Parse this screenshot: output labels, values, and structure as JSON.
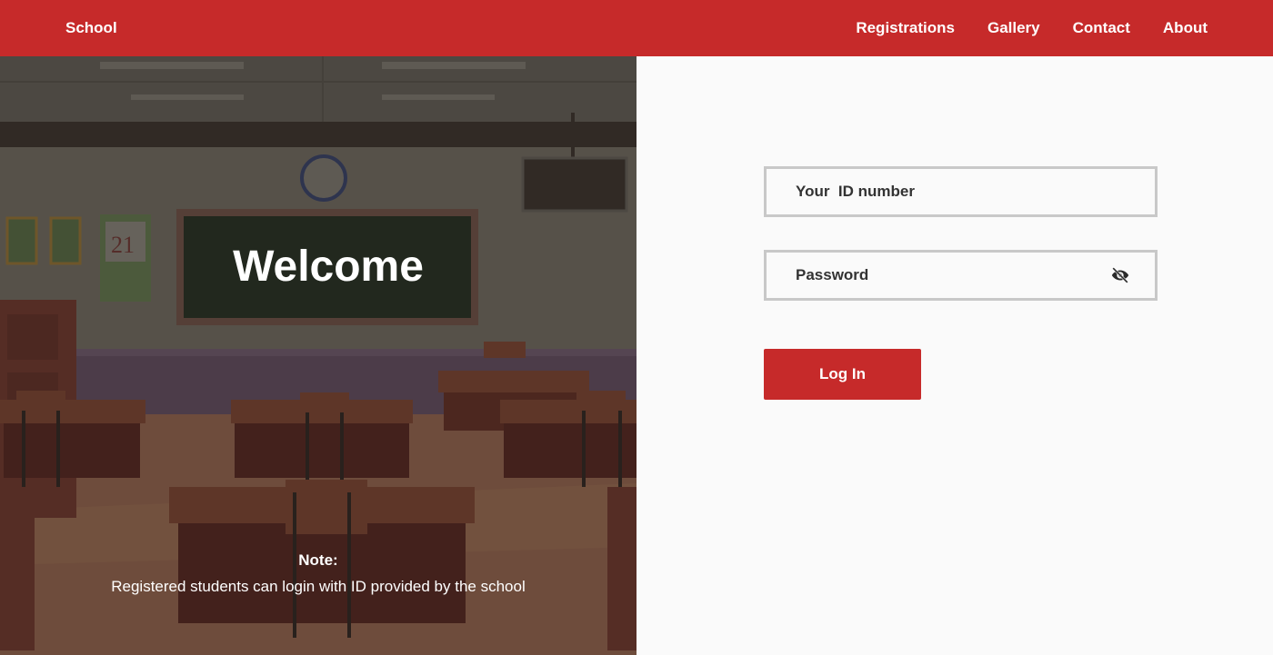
{
  "nav": {
    "brand": "School",
    "links": [
      "Registrations",
      "Gallery",
      "Contact",
      "About"
    ]
  },
  "hero": {
    "welcome": "Welcome",
    "note_title": "Note:",
    "note_text": "Registered students can login with ID provided by the school",
    "poster_number": "21"
  },
  "login": {
    "id_placeholder": "Your  ID number",
    "password_placeholder": "Password",
    "password_toggle_icon": "eye-slash-icon",
    "submit_label": "Log In"
  },
  "colors": {
    "primary": "#c62a2a",
    "background": "#fafafa",
    "field_border": "#c8c8c8"
  }
}
